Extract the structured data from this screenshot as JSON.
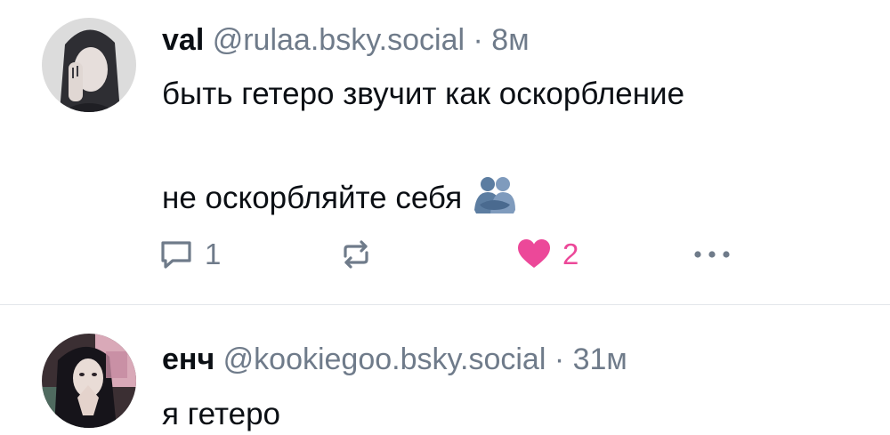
{
  "posts": [
    {
      "author_name": "val",
      "handle": "@rulaa.bsky.social",
      "separator": "·",
      "time": "8м",
      "text_line_1": "быть гетеро звучит как оскорбление",
      "text_line_2": "не оскорбляйте себя",
      "emoji": "people-hugging-icon",
      "reply_count": "1",
      "like_count": "2"
    },
    {
      "author_name": "енч",
      "handle": "@kookiegoo.bsky.social",
      "separator": "·",
      "time": "31м",
      "text_line_1": "я гетеро"
    }
  ],
  "colors": {
    "text": "#0b0f14",
    "muted": "#6f7b8a",
    "like": "#ec4899",
    "divider": "#e3e6ea"
  }
}
